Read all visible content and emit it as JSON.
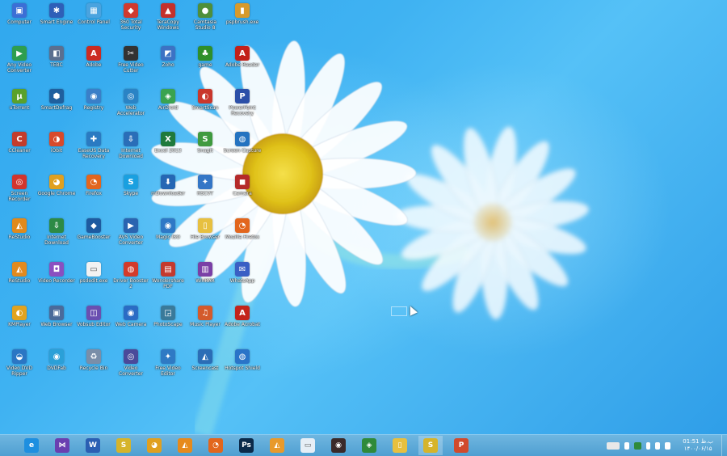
{
  "desktop": {
    "icons": [
      {
        "label": "Computer",
        "glyph": "▣",
        "color": "#3b6fd6"
      },
      {
        "label": "Smart Engine",
        "glyph": "✱",
        "color": "#2e5fb8"
      },
      {
        "label": "Control Panel",
        "glyph": "▦",
        "color": "#4aa3df"
      },
      {
        "label": "360 Total Security",
        "glyph": "◆",
        "color": "#d03a2f"
      },
      {
        "label": "TeraCopy Windows",
        "glyph": "▲",
        "color": "#c4302b"
      },
      {
        "label": "Camtasia Studio 8",
        "glyph": "●",
        "color": "#4f8f3a"
      },
      {
        "label": "pspbrush.exe",
        "glyph": "▮",
        "color": "#d79a2b"
      },
      {
        "label": "Any Video Converter",
        "glyph": "▶",
        "color": "#2e9e4f"
      },
      {
        "label": "TEBC",
        "glyph": "◧",
        "color": "#5b6f8f"
      },
      {
        "label": "Adobe",
        "glyph": "A",
        "color": "#cc2b22"
      },
      {
        "label": "Free Video Cutter",
        "glyph": "✂",
        "color": "#333333"
      },
      {
        "label": "Zoho",
        "glyph": "◩",
        "color": "#3c72c4"
      },
      {
        "label": "game",
        "glyph": "♣",
        "color": "#2f8f2a"
      },
      {
        "label": "Adobe Reader",
        "glyph": "A",
        "color": "#c32019"
      },
      {
        "label": "uTorrent",
        "glyph": "µ",
        "color": "#5aa12b"
      },
      {
        "label": "SmartDefrag",
        "glyph": "⬢",
        "color": "#1f5f9e"
      },
      {
        "label": "Registry",
        "glyph": "◉",
        "color": "#3a7fc8"
      },
      {
        "label": "Web Accelerator",
        "glyph": "◎",
        "color": "#2a83c5"
      },
      {
        "label": "AirDroid",
        "glyph": "◈",
        "color": "#3aa350"
      },
      {
        "label": "SmartScan",
        "glyph": "◐",
        "color": "#c9372c"
      },
      {
        "label": "PowerPoint Recovery",
        "glyph": "P",
        "color": "#2b4fa8"
      },
      {
        "label": "CCleaner",
        "glyph": "C",
        "color": "#c33c2c"
      },
      {
        "label": "iObit",
        "glyph": "◑",
        "color": "#d84a2c"
      },
      {
        "label": "EaseUS Data Recovery",
        "glyph": "✚",
        "color": "#2a7ac2"
      },
      {
        "label": "Internet Download",
        "glyph": "⇩",
        "color": "#2a6eb8"
      },
      {
        "label": "Excel 2013",
        "glyph": "X",
        "color": "#1f7a3c"
      },
      {
        "label": "SnagIt",
        "glyph": "S",
        "color": "#3f9a3f"
      },
      {
        "label": "Screen Capture",
        "glyph": "◍",
        "color": "#2473c0"
      },
      {
        "label": "Screen Recorder",
        "glyph": "◎",
        "color": "#d2352d"
      },
      {
        "label": "Google Chrome",
        "glyph": "◕",
        "color": "#e0a020"
      },
      {
        "label": "Firefox",
        "glyph": "◔",
        "color": "#e2661d"
      },
      {
        "label": "Skype",
        "glyph": "S",
        "color": "#1aa0e0"
      },
      {
        "label": "mDownloader",
        "glyph": "⬇",
        "color": "#2567b4"
      },
      {
        "label": "RSCVT",
        "glyph": "✦",
        "color": "#3476c6"
      },
      {
        "label": "Camera",
        "glyph": "◼",
        "color": "#b52a2a"
      },
      {
        "label": "ReStudio",
        "glyph": "◭",
        "color": "#e08a1c"
      },
      {
        "label": "Internet Download",
        "glyph": "⇩",
        "color": "#2d8a45"
      },
      {
        "label": "GameBooster",
        "glyph": "◆",
        "color": "#1e5aa0"
      },
      {
        "label": "AVS Video Converter",
        "glyph": "▶",
        "color": "#2a64b0"
      },
      {
        "label": "Magic ISO",
        "glyph": "◉",
        "color": "#2e78c6"
      },
      {
        "label": "File Browser",
        "glyph": "▯",
        "color": "#e7c040"
      },
      {
        "label": "Mozilla Firefox",
        "glyph": "◔",
        "color": "#e2661d"
      },
      {
        "label": "ReStudio",
        "glyph": "◭",
        "color": "#e28a1e"
      },
      {
        "label": "Video Recorder",
        "glyph": "◘",
        "color": "#8a4fc0"
      },
      {
        "label": "psdedit.exe",
        "glyph": "▭",
        "color": "#f2f2f2"
      },
      {
        "label": "Driver Booster 2",
        "glyph": "◍",
        "color": "#d33b2b"
      },
      {
        "label": "Wondershare PDF",
        "glyph": "▤",
        "color": "#c43a2e"
      },
      {
        "label": "WinRAR",
        "glyph": "▥",
        "color": "#7a3fa6"
      },
      {
        "label": "WhatsApp",
        "glyph": "✉",
        "color": "#3a5fc4"
      },
      {
        "label": "KMPlayer",
        "glyph": "◐",
        "color": "#e0a320"
      },
      {
        "label": "Web Browser",
        "glyph": "▣",
        "color": "#4a6a9a"
      },
      {
        "label": "Vobsub Editor",
        "glyph": "◫",
        "color": "#6a4fb0"
      },
      {
        "label": "Web Camera",
        "glyph": "◉",
        "color": "#2a6cc4"
      },
      {
        "label": "PhotoScape",
        "glyph": "◲",
        "color": "#3a7a9a"
      },
      {
        "label": "Music Player",
        "glyph": "♫",
        "color": "#d35a2c"
      },
      {
        "label": "Adobe Acrobat",
        "glyph": "A",
        "color": "#c4241a"
      },
      {
        "label": "Video DVD Ripper",
        "glyph": "◒",
        "color": "#2a76c4"
      },
      {
        "label": "DVDFab",
        "glyph": "◉",
        "color": "#2aa0d8"
      },
      {
        "label": "Recycle Bin",
        "glyph": "♻",
        "color": "#7a8ea8"
      },
      {
        "label": "Video Converter",
        "glyph": "◎",
        "color": "#4a4a9a"
      },
      {
        "label": "Free Video Editor",
        "glyph": "✦",
        "color": "#2f7ac4"
      },
      {
        "label": "Screencast",
        "glyph": "◭",
        "color": "#2b6db6"
      },
      {
        "label": "Hotspot Shield",
        "glyph": "◍",
        "color": "#2a74c8"
      }
    ]
  },
  "taskbar": {
    "apps": [
      {
        "name": "internet-explorer",
        "glyph": "e",
        "color": "#1e8fe0",
        "active": false
      },
      {
        "name": "visual-studio",
        "glyph": "⋈",
        "color": "#6a3fb0",
        "active": false
      },
      {
        "name": "word",
        "glyph": "W",
        "color": "#2b5fb3",
        "active": false
      },
      {
        "name": "app-s",
        "glyph": "S",
        "color": "#d6b42a",
        "active": false
      },
      {
        "name": "chrome",
        "glyph": "◕",
        "color": "#e0a020",
        "active": false
      },
      {
        "name": "restudio",
        "glyph": "◭",
        "color": "#e68a1c",
        "active": false
      },
      {
        "name": "firefox",
        "glyph": "◔",
        "color": "#e2661d",
        "active": false
      },
      {
        "name": "photoshop",
        "glyph": "Ps",
        "color": "#0b2a4a",
        "active": false
      },
      {
        "name": "restudio-2",
        "glyph": "◭",
        "color": "#e89a2c",
        "active": false
      },
      {
        "name": "notepad",
        "glyph": "▭",
        "color": "#e6eef6",
        "active": false
      },
      {
        "name": "media-app",
        "glyph": "◉",
        "color": "#3a2a2a",
        "active": false
      },
      {
        "name": "network-app",
        "glyph": "◈",
        "color": "#2f8a3a",
        "active": false
      },
      {
        "name": "file-explorer",
        "glyph": "▯",
        "color": "#e7c040",
        "active": false
      },
      {
        "name": "app-s-2",
        "glyph": "S",
        "color": "#d6b42a",
        "active": true
      },
      {
        "name": "powerpoint",
        "glyph": "P",
        "color": "#d14a2c",
        "active": false
      }
    ],
    "tray": {
      "clock_time": "01:51 ب.ظ",
      "clock_date": "۱۴۰۰/۰۶/۱۵",
      "icon_colors": [
        "#e8e8e8",
        "#2f8a3a",
        "#ffffff",
        "#ffffff",
        "#ffffff"
      ]
    }
  }
}
